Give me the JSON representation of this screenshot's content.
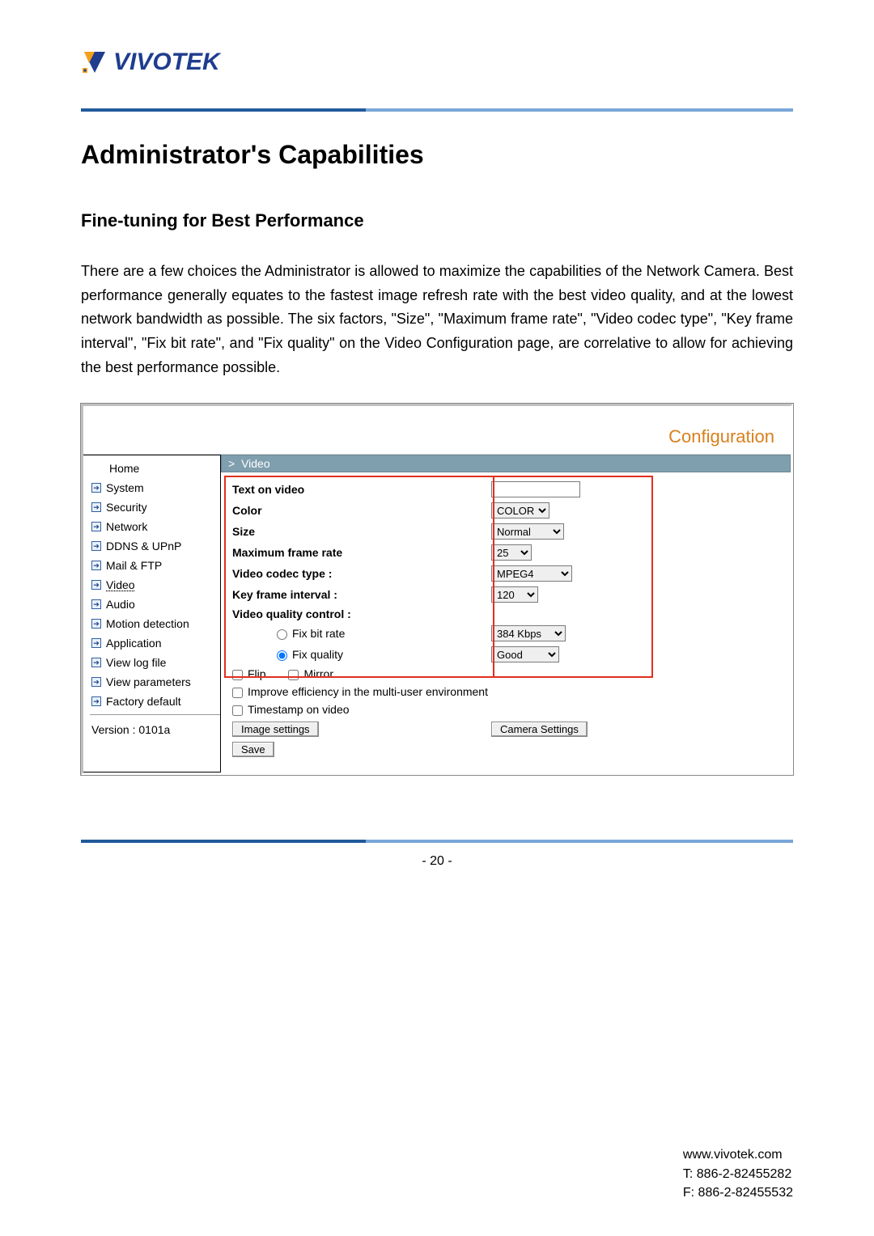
{
  "brand": {
    "word": "VIVOTEK"
  },
  "page_title": "Administrator's Capabilities",
  "section_title": "Fine-tuning for Best Performance",
  "body_para": "There are a few choices the Administrator is allowed to maximize the capabilities of the Network Camera. Best performance generally equates to the fastest image refresh rate with the best video quality, and at the lowest network bandwidth as possible. The six factors, \"Size\", \"Maximum frame rate\", \"Video codec type\", \"Key frame interval\", \"Fix bit rate\", and \"Fix quality\" on the Video Configuration page, are correlative to allow for achieving the best performance possible.",
  "config": {
    "header": "Configuration",
    "crumb_prefix": ">",
    "crumb": "Video",
    "sidebar": {
      "home": "Home",
      "items": [
        "System",
        "Security",
        "Network",
        "DDNS & UPnP",
        "Mail & FTP",
        "Video",
        "Audio",
        "Motion detection",
        "Application",
        "View log file",
        "View parameters",
        "Factory default"
      ],
      "version": "Version : 0101a"
    },
    "form": {
      "text_on_video": {
        "label": "Text on video",
        "value": ""
      },
      "color": {
        "label": "Color",
        "value": "COLOR"
      },
      "size": {
        "label": "Size",
        "value": "Normal"
      },
      "max_frame": {
        "label": "Maximum frame rate",
        "value": "25"
      },
      "codec": {
        "label": "Video codec type :",
        "value": "MPEG4"
      },
      "keyframe": {
        "label": "Key frame interval :",
        "value": "120"
      },
      "quality_header": "Video quality control :",
      "fix_bit": {
        "label": "Fix bit rate",
        "value": "384 Kbps"
      },
      "fix_quality": {
        "label": "Fix quality",
        "value": "Good"
      },
      "flip": "Flip",
      "mirror": "Mirror",
      "improve": "Improve efficiency in the multi-user environment",
      "timestamp": "Timestamp on video",
      "image_settings_btn": "Image settings",
      "camera_settings_btn": "Camera  Settings",
      "save_btn": "Save"
    }
  },
  "page_number": "- 20 -",
  "footer": {
    "url": "www.vivotek.com",
    "tel": "T: 886-2-82455282",
    "fax": "F: 886-2-82455532"
  }
}
